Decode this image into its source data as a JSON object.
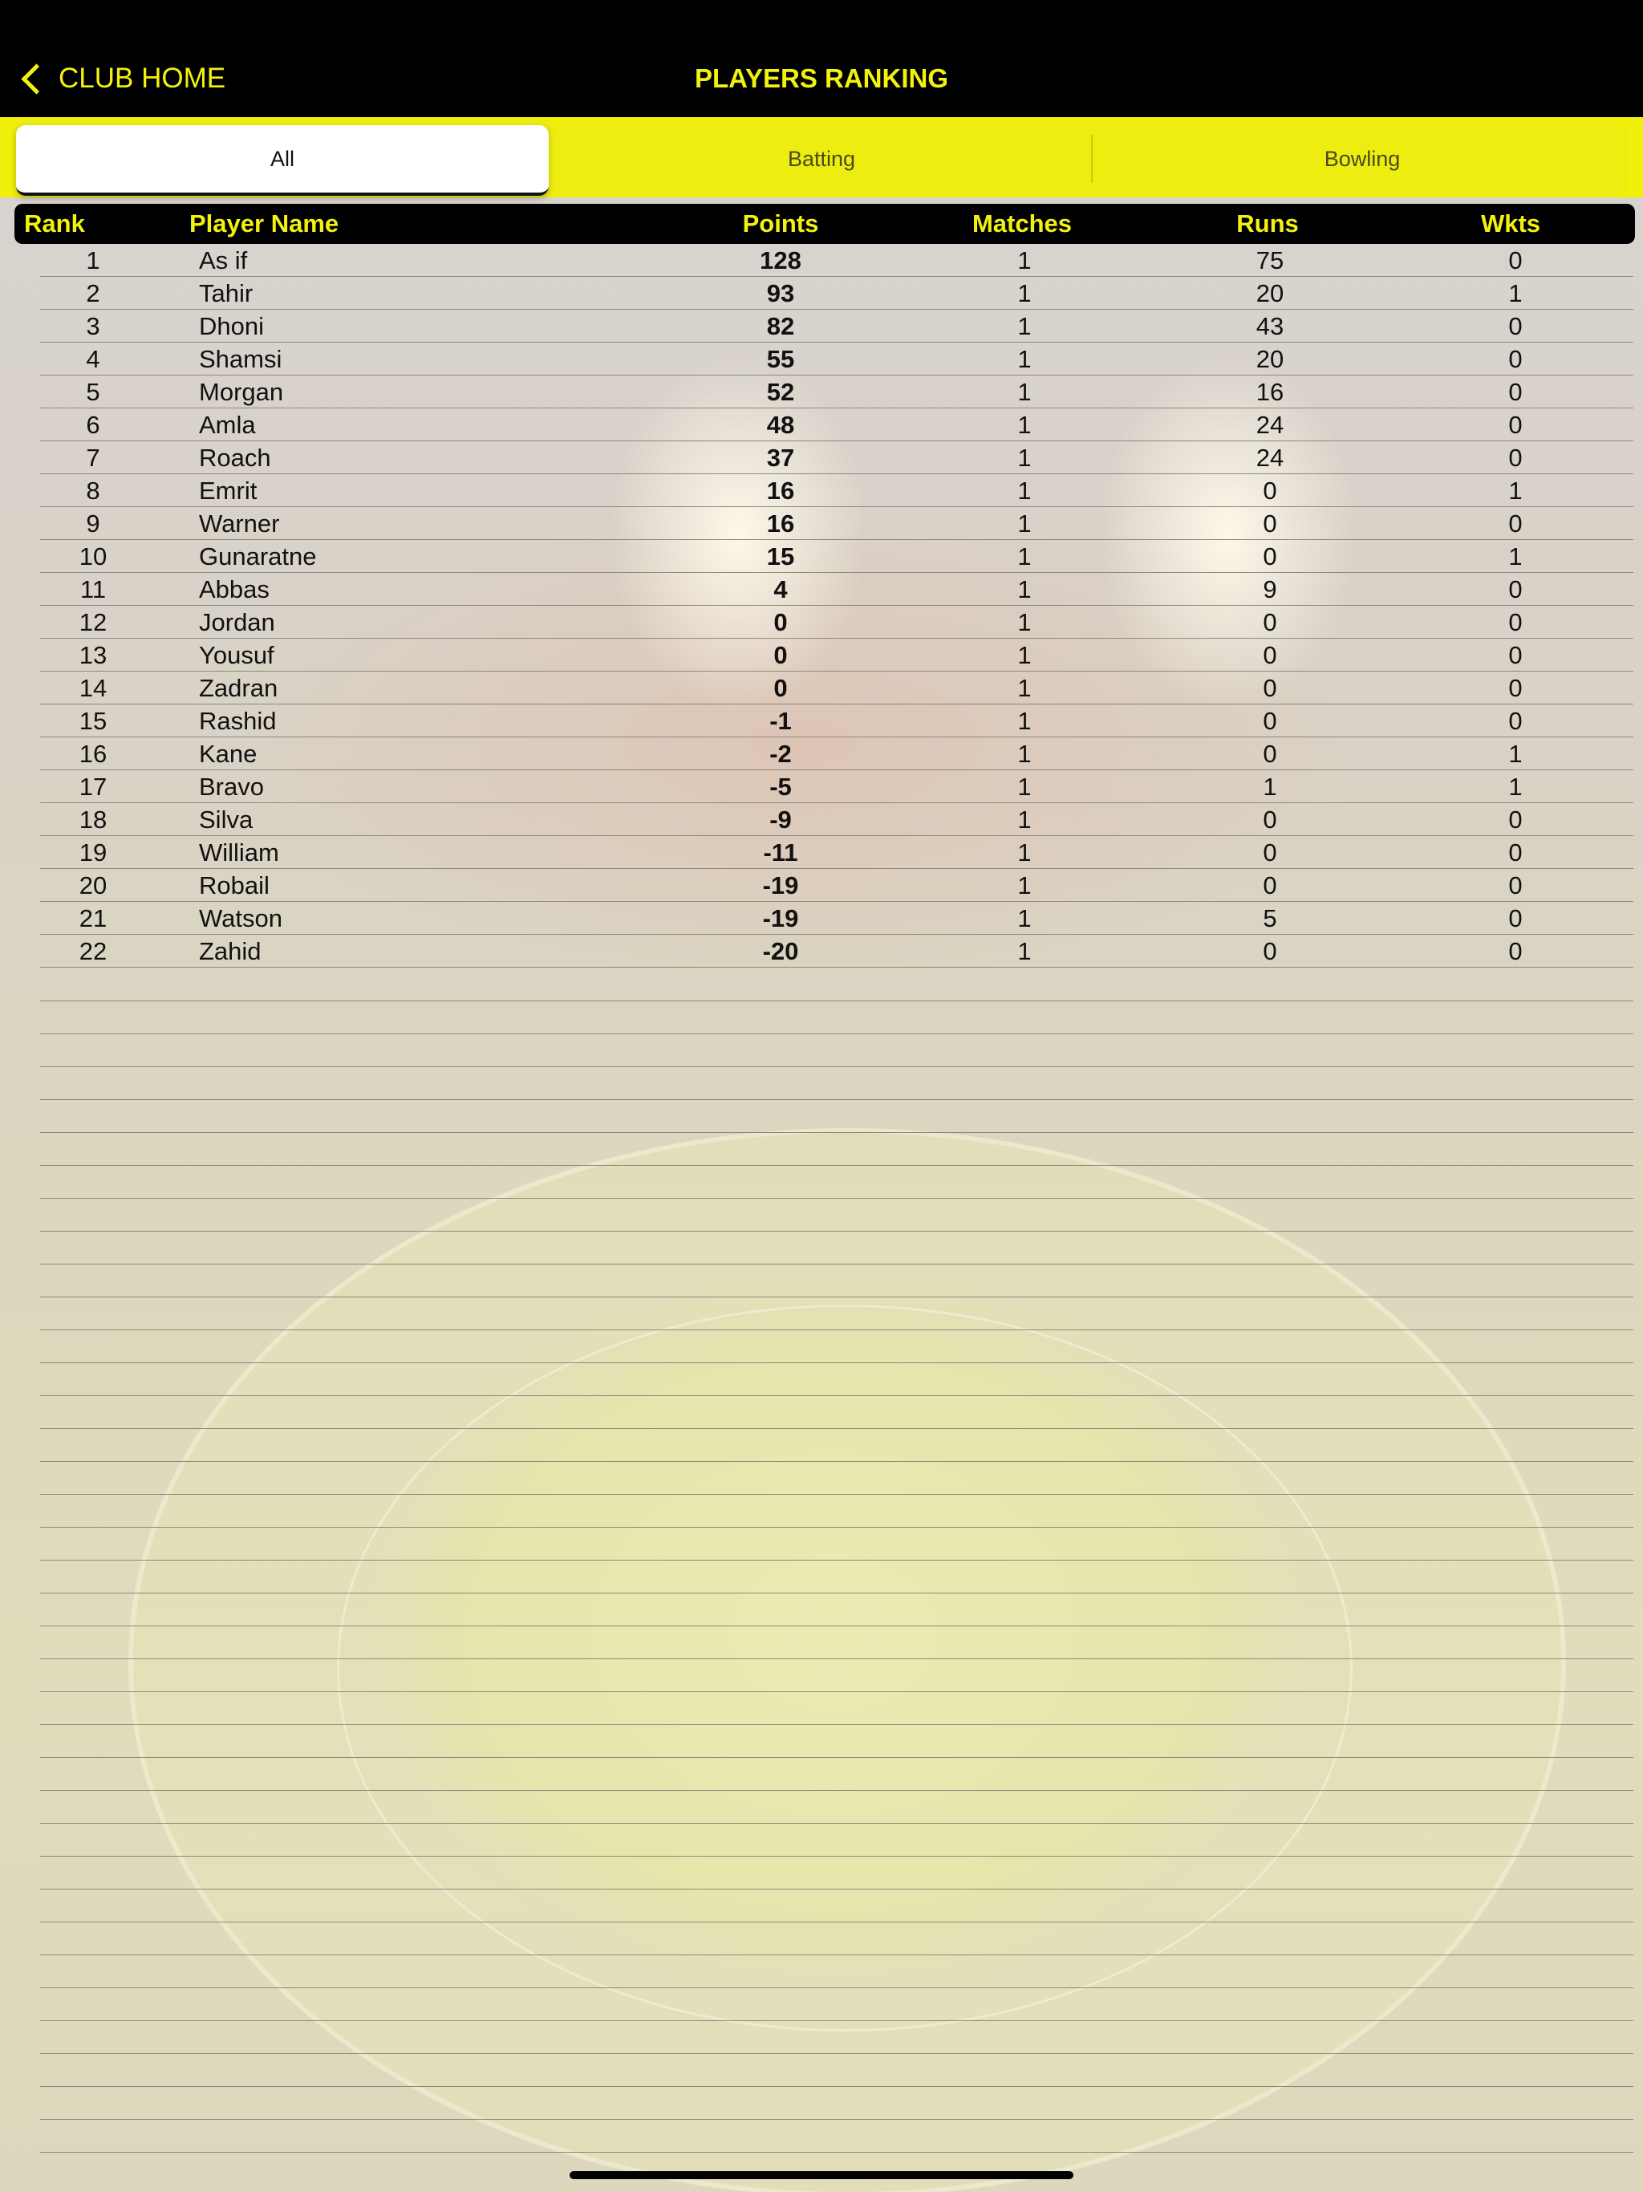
{
  "nav": {
    "back_label": "CLUB HOME",
    "title": "PLAYERS RANKING"
  },
  "tabs": [
    {
      "label": "All",
      "active": true
    },
    {
      "label": "Batting",
      "active": false
    },
    {
      "label": "Bowling",
      "active": false
    }
  ],
  "table": {
    "columns": [
      "Rank",
      "Player Name",
      "Points",
      "Matches",
      "Runs",
      "Wkts"
    ],
    "rows": [
      {
        "rank": "1",
        "name": "As if",
        "points": "128",
        "matches": "1",
        "runs": "75",
        "wkts": "0"
      },
      {
        "rank": "2",
        "name": "Tahir",
        "points": "93",
        "matches": "1",
        "runs": "20",
        "wkts": "1"
      },
      {
        "rank": "3",
        "name": "Dhoni",
        "points": "82",
        "matches": "1",
        "runs": "43",
        "wkts": "0"
      },
      {
        "rank": "4",
        "name": "Shamsi",
        "points": "55",
        "matches": "1",
        "runs": "20",
        "wkts": "0"
      },
      {
        "rank": "5",
        "name": "Morgan",
        "points": "52",
        "matches": "1",
        "runs": "16",
        "wkts": "0"
      },
      {
        "rank": "6",
        "name": "Amla",
        "points": "48",
        "matches": "1",
        "runs": "24",
        "wkts": "0"
      },
      {
        "rank": "7",
        "name": "Roach",
        "points": "37",
        "matches": "1",
        "runs": "24",
        "wkts": "0"
      },
      {
        "rank": "8",
        "name": "Emrit",
        "points": "16",
        "matches": "1",
        "runs": "0",
        "wkts": "1"
      },
      {
        "rank": "9",
        "name": "Warner",
        "points": "16",
        "matches": "1",
        "runs": "0",
        "wkts": "0"
      },
      {
        "rank": "10",
        "name": "Gunaratne",
        "points": "15",
        "matches": "1",
        "runs": "0",
        "wkts": "1"
      },
      {
        "rank": "11",
        "name": "Abbas",
        "points": "4",
        "matches": "1",
        "runs": "9",
        "wkts": "0"
      },
      {
        "rank": "12",
        "name": "Jordan",
        "points": "0",
        "matches": "1",
        "runs": "0",
        "wkts": "0"
      },
      {
        "rank": "13",
        "name": "Yousuf",
        "points": "0",
        "matches": "1",
        "runs": "0",
        "wkts": "0"
      },
      {
        "rank": "14",
        "name": "Zadran",
        "points": "0",
        "matches": "1",
        "runs": "0",
        "wkts": "0"
      },
      {
        "rank": "15",
        "name": "Rashid",
        "points": "-1",
        "matches": "1",
        "runs": "0",
        "wkts": "0"
      },
      {
        "rank": "16",
        "name": "Kane",
        "points": "-2",
        "matches": "1",
        "runs": "0",
        "wkts": "1"
      },
      {
        "rank": "17",
        "name": "Bravo",
        "points": "-5",
        "matches": "1",
        "runs": "1",
        "wkts": "1"
      },
      {
        "rank": "18",
        "name": "Silva",
        "points": "-9",
        "matches": "1",
        "runs": "0",
        "wkts": "0"
      },
      {
        "rank": "19",
        "name": "William",
        "points": "-11",
        "matches": "1",
        "runs": "0",
        "wkts": "0"
      },
      {
        "rank": "20",
        "name": "Robail",
        "points": "-19",
        "matches": "1",
        "runs": "0",
        "wkts": "0"
      },
      {
        "rank": "21",
        "name": "Watson",
        "points": "-19",
        "matches": "1",
        "runs": "5",
        "wkts": "0"
      },
      {
        "rank": "22",
        "name": "Zahid",
        "points": "-20",
        "matches": "1",
        "runs": "0",
        "wkts": "0"
      }
    ]
  },
  "colors": {
    "accent": "#f2f20f",
    "nav_bg": "#000000"
  }
}
